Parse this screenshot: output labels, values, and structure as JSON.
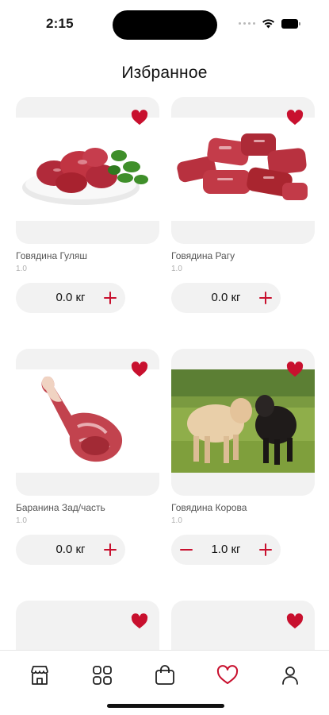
{
  "status": {
    "time": "2:15"
  },
  "header": {
    "title": "Избранное"
  },
  "colors": {
    "accent": "#c8102e",
    "card_bg": "#f2f2f2"
  },
  "products": [
    {
      "name": "Говядина Гуляш",
      "qty_label": "1.0",
      "amount": "0.0 кг",
      "favorite": true,
      "has_minus": false,
      "image": "beef-goulash-photo"
    },
    {
      "name": "Говядина Рагу",
      "qty_label": "1.0",
      "amount": "0.0 кг",
      "favorite": true,
      "has_minus": false,
      "image": "beef-stew-photo"
    },
    {
      "name": "Баранина Зад/часть",
      "qty_label": "1.0",
      "amount": "0.0 кг",
      "favorite": true,
      "has_minus": false,
      "image": "lamb-leg-photo"
    },
    {
      "name": "Говядина  Корова",
      "qty_label": "1.0",
      "amount": "1.0 кг",
      "favorite": true,
      "has_minus": true,
      "image": "cows-photo"
    },
    {
      "favorite": true
    },
    {
      "favorite": true
    }
  ],
  "nav": [
    {
      "icon": "shop-icon",
      "active": false
    },
    {
      "icon": "catalog-grid-icon",
      "active": false
    },
    {
      "icon": "cart-bag-icon",
      "active": false
    },
    {
      "icon": "favorites-heart-icon",
      "active": true
    },
    {
      "icon": "profile-icon",
      "active": false
    }
  ]
}
